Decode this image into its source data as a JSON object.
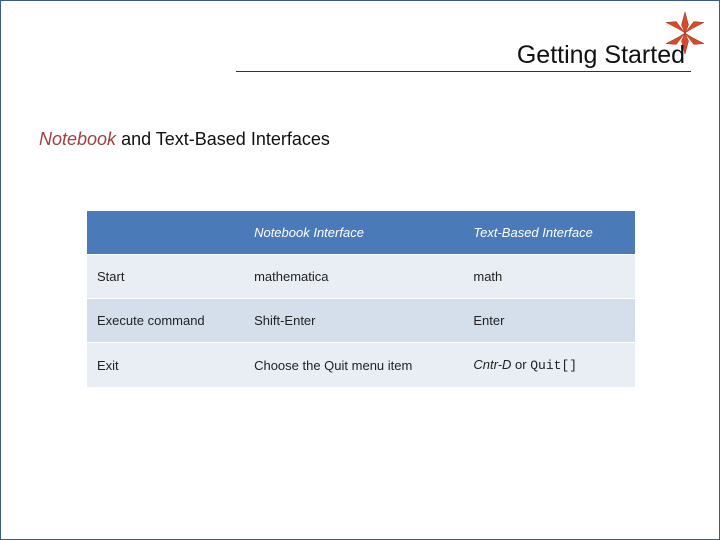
{
  "header": {
    "title": "Getting Started"
  },
  "subtitle": {
    "italic_prefix": "Notebook",
    "rest": " and Text-Based Interfaces"
  },
  "table": {
    "columns": [
      "",
      "Notebook Interface",
      "Text-Based Interface"
    ],
    "rows": [
      {
        "label": "Start",
        "notebook": "mathematica",
        "textbased": "math"
      },
      {
        "label": "Execute command",
        "notebook": "Shift-Enter",
        "textbased": "Enter"
      },
      {
        "label": "Exit",
        "notebook": "Choose the Quit menu item",
        "textbased_prefix_italic": "Cntr-D",
        "textbased_mid": " or ",
        "textbased_mono": "Quit[]"
      }
    ]
  },
  "logo": {
    "name": "mathematica-spikey-icon"
  }
}
